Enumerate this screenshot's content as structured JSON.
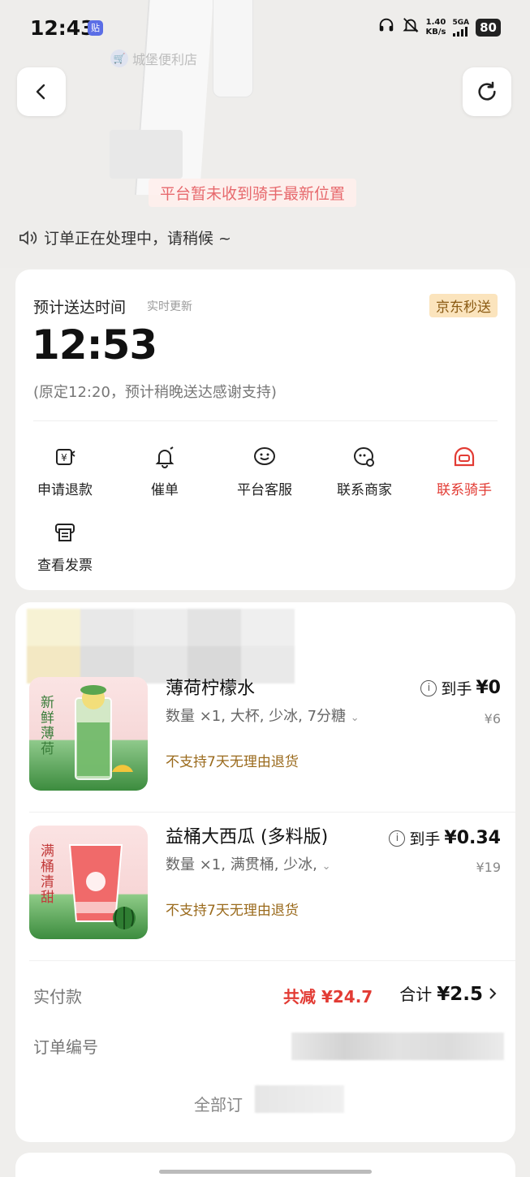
{
  "status_bar": {
    "time": "12:43",
    "notif_badge": "贴",
    "speed_value": "1.40",
    "speed_unit": "KB/s",
    "network": "5GA",
    "battery": "80"
  },
  "map": {
    "store_name": "城堡便利店",
    "rider_tip": "平台暂未收到骑手最新位置"
  },
  "processing_text": "订单正在处理中，请稍候 ~",
  "delivery": {
    "eta_label": "预计送达时间",
    "live_update": "实时更新",
    "badge": "京东秒送",
    "eta_time": "12:53",
    "eta_note": "(原定12:20，预计稍晚送达感谢支持)"
  },
  "actions": [
    {
      "label": "申请退款",
      "icon": "refund-icon"
    },
    {
      "label": "催单",
      "icon": "bell-icon"
    },
    {
      "label": "平台客服",
      "icon": "customer-service-icon"
    },
    {
      "label": "联系商家",
      "icon": "merchant-chat-icon"
    },
    {
      "label": "联系骑手",
      "icon": "rider-icon"
    },
    {
      "label": "查看发票",
      "icon": "invoice-icon"
    }
  ],
  "items": [
    {
      "name": "薄荷柠檬水",
      "spec": "数量 ×1, 大杯, 少冰, 7分糖",
      "policy": "不支持7天无理由退货",
      "net_label": "到手",
      "net_price": "¥0",
      "orig_price": "¥6",
      "thumb_text": "新鲜薄荷"
    },
    {
      "name": "益桶大西瓜 (多料版)",
      "spec": "数量 ×1, 满贯桶, 少冰,",
      "policy": "不支持7天无理由退货",
      "net_label": "到手",
      "net_price": "¥0.34",
      "orig_price": "¥19",
      "thumb_text": "满桶清甜"
    }
  ],
  "summary": {
    "paid_label": "实付款",
    "discount": "共减 ¥24.7",
    "total_label": "合计",
    "total_value": "¥2.5",
    "order_no_label": "订单编号",
    "view_all": "全部订"
  },
  "colors": {
    "accent_red": "#e23b34",
    "policy_gold": "#9a6a1c",
    "badge_bg": "#fbe4bd"
  }
}
